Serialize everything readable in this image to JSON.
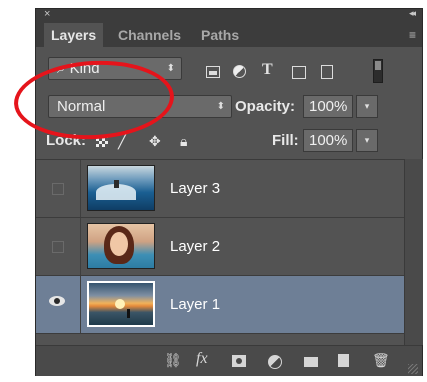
{
  "panel": {
    "tabs": [
      {
        "label": "Layers",
        "active": true
      },
      {
        "label": "Channels",
        "active": false
      },
      {
        "label": "Paths",
        "active": false
      }
    ],
    "close_glyph": "×",
    "collapse_glyph": "◂◂",
    "menu_glyph": "≡"
  },
  "filter": {
    "kind_label": "Kind",
    "kind_icon": "search-icon",
    "filter_icons": [
      "pixel-layer-filter-icon",
      "adjustment-layer-filter-icon",
      "type-layer-filter-icon",
      "shape-layer-filter-icon",
      "smart-object-filter-icon"
    ]
  },
  "blend": {
    "mode": "Normal",
    "opacity_label": "Opacity:",
    "opacity_value": "100%"
  },
  "lock": {
    "label": "Lock:",
    "fill_label": "Fill:",
    "fill_value": "100%"
  },
  "layers": [
    {
      "name": "Layer 3",
      "visible": false,
      "selected": false,
      "thumbnail": "surfer-wave"
    },
    {
      "name": "Layer 2",
      "visible": false,
      "selected": false,
      "thumbnail": "woman-portrait"
    },
    {
      "name": "Layer 1",
      "visible": true,
      "selected": true,
      "thumbnail": "beach-sunset"
    }
  ],
  "bottom_icons": [
    "link-layers-icon",
    "fx-icon",
    "add-mask-icon",
    "new-adjustment-icon",
    "new-group-icon",
    "new-layer-icon",
    "delete-layer-icon"
  ],
  "colors": {
    "panel_bg": "#535353",
    "selected_row": "#6e7f96",
    "annotation": "#e5141b"
  }
}
